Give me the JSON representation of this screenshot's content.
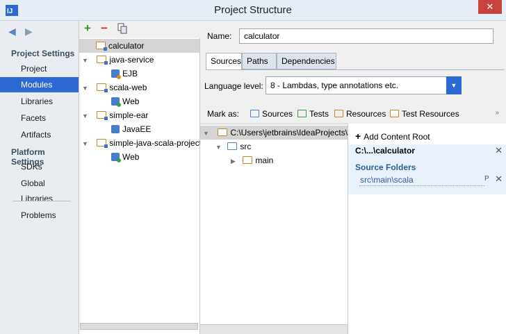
{
  "window": {
    "title": "Project Structure",
    "app_icon": "intellij-icon",
    "close_label": "✕"
  },
  "nav": {
    "back_icon": "back-arrow-icon",
    "forward_icon": "forward-arrow-icon",
    "project_settings_header": "Project Settings",
    "project_settings_items": [
      "Project",
      "Modules",
      "Libraries",
      "Facets",
      "Artifacts"
    ],
    "selected": "Modules",
    "platform_settings_header": "Platform Settings",
    "platform_settings_items": [
      "SDKs",
      "Global Libraries"
    ],
    "problems": "Problems"
  },
  "toolbar": {
    "add_label": "+",
    "remove_label": "−",
    "copy_icon": "copy-icon"
  },
  "modules": [
    {
      "label": "calculator",
      "icon": "module-folder-icon",
      "selected": true
    },
    {
      "label": "java-service",
      "icon": "module-folder-icon",
      "children": [
        {
          "label": "EJB",
          "icon": "ejb-facet-icon"
        }
      ]
    },
    {
      "label": "scala-web",
      "icon": "module-folder-icon",
      "children": [
        {
          "label": "Web",
          "icon": "web-facet-icon"
        }
      ]
    },
    {
      "label": "simple-ear",
      "icon": "module-folder-icon",
      "children": [
        {
          "label": "JavaEE",
          "icon": "javaee-facet-icon"
        }
      ]
    },
    {
      "label": "simple-java-scala-project",
      "icon": "module-folder-icon",
      "children": [
        {
          "label": "Web",
          "icon": "web-facet-icon"
        }
      ]
    }
  ],
  "detail": {
    "name_label": "Name:",
    "name_value": "calculator",
    "tabs": [
      "Sources",
      "Paths",
      "Dependencies"
    ],
    "active_tab": "Sources",
    "language_level_label": "Language level:",
    "language_level_value": "8 - Lambdas, type annotations etc.",
    "mark_as_label": "Mark as:",
    "mark_as_options": [
      "Sources",
      "Tests",
      "Resources",
      "Test Resources"
    ],
    "more_label": "»"
  },
  "content_tree": {
    "root_path": "C:\\Users\\jetbrains\\IdeaProjects\\s",
    "src": "src",
    "main": "main"
  },
  "content_root": {
    "add_label": "Add Content Root",
    "root_label": "C:\\...\\calculator",
    "source_folders_label": "Source Folders",
    "source_folder": "src\\main\\scala",
    "remove_label": "✕",
    "properties_label": "P"
  },
  "colors": {
    "selection": "#2c6ad1",
    "sources": "#4a86c5",
    "tests": "#3a9a41",
    "resources": "#c48a2c"
  }
}
